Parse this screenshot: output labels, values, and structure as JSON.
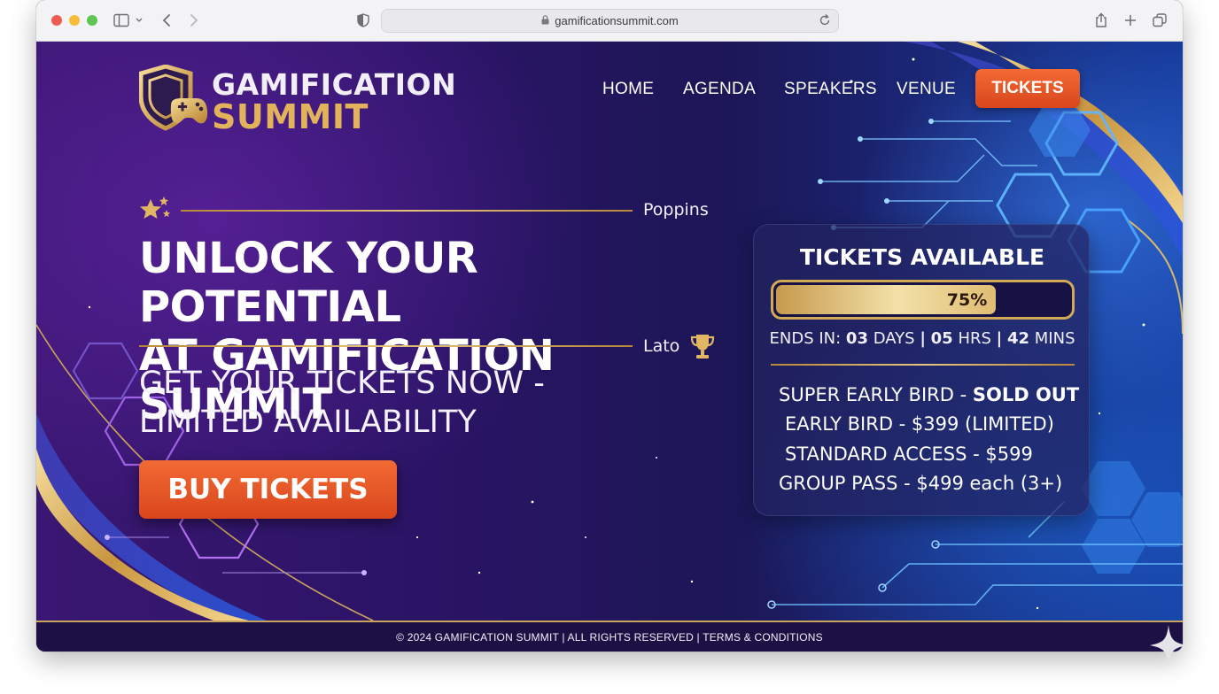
{
  "browser": {
    "url": "gamificationsummit.com"
  },
  "logo": {
    "line1": "GAMIFICATION",
    "line2": "SUMMIT"
  },
  "nav": {
    "items": [
      "HOME",
      "AGENDA",
      "SPEAKERS",
      "VENUE"
    ],
    "cta": "TICKETS"
  },
  "hero": {
    "font_label_top": "Poppins",
    "headline_line1": "UNLOCK YOUR POTENTIAL",
    "headline_line2": "AT GAMIFICATION SUMMIT",
    "font_label_bottom": "Lato",
    "subhead_line1": "GET YOUR TICKETS NOW -",
    "subhead_line2": "LIMITED AVAILABILITY",
    "button": "BUY TICKETS"
  },
  "tickets_panel": {
    "title": "TICKETS AVAILABLE",
    "progress_percent": 75,
    "progress_label": "75%",
    "countdown": {
      "prefix": "ENDS IN:",
      "days_value": "03",
      "days_unit": "DAYS",
      "hours_value": "05",
      "hours_unit": "HRS",
      "mins_value": "42",
      "mins_unit": "MINS",
      "separator": "|"
    },
    "tiers": [
      {
        "name": "SUPER EARLY BIRD -",
        "detail": "SOLD OUT"
      },
      {
        "name": "EARLY BIRD - $399 (LIMITED)",
        "detail": ""
      },
      {
        "name": "STANDARD ACCESS - $599",
        "detail": ""
      },
      {
        "name": "GROUP PASS - $499 each (3+)",
        "detail": ""
      }
    ]
  },
  "footer": {
    "text": "© 2024 GAMIFICATION SUMMIT | ALL RIGHTS RESERVED | TERMS & CONDITIONS"
  },
  "colors": {
    "accent_orange": "#e8532a",
    "gold": "#d3a955",
    "deep_purple": "#2a1465",
    "blue": "#173c9e"
  }
}
